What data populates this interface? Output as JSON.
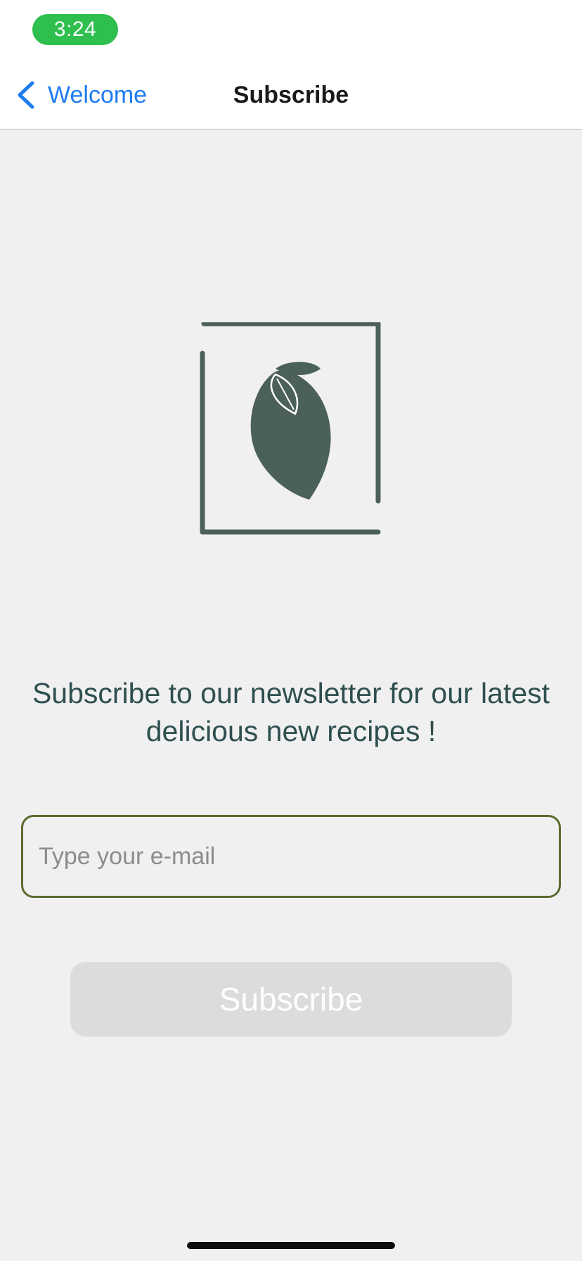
{
  "status_bar": {
    "time": "3:24"
  },
  "nav": {
    "back_label": "Welcome",
    "title": "Subscribe",
    "back_icon": "chevron-left-icon"
  },
  "logo": {
    "icon": "lemon-leaf-logo",
    "color": "#4b6158"
  },
  "main": {
    "headline": "Subscribe to our newsletter for our latest delicious new recipes !"
  },
  "form": {
    "email_placeholder": "Type your e-mail",
    "email_value": "",
    "submit_label": "Subscribe"
  },
  "colors": {
    "accent": "#1e7cf0",
    "status_pill": "#2fbf4f",
    "field_border": "#5a6b2e",
    "text_dark_green": "#2f4f4f",
    "button_disabled": "#dcdcdc"
  }
}
